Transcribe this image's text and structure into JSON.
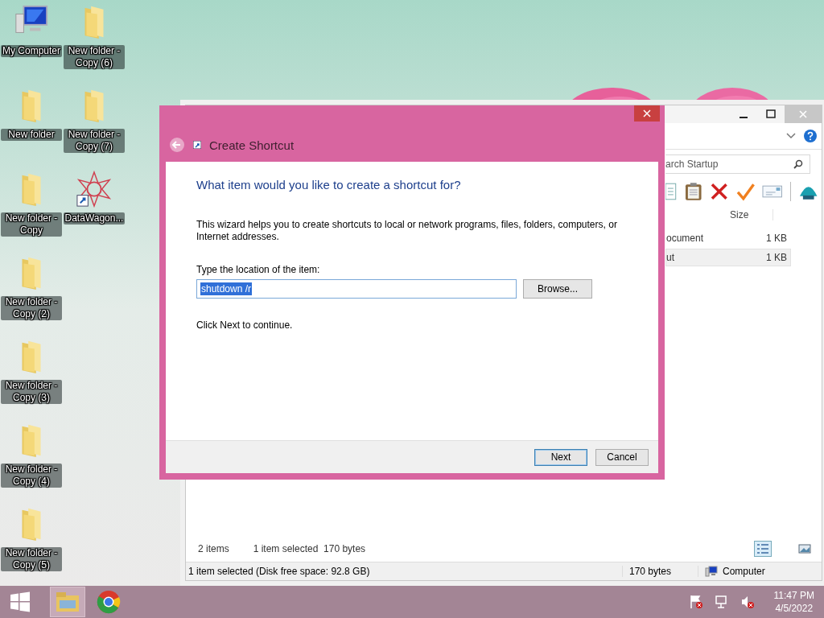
{
  "desktop_icons": [
    {
      "label": "My Computer",
      "kind": "computer"
    },
    {
      "label": "New folder",
      "kind": "folder"
    },
    {
      "label": "New folder - Copy",
      "kind": "folder"
    },
    {
      "label": "New folder - Copy (2)",
      "kind": "folder"
    },
    {
      "label": "New folder - Copy (3)",
      "kind": "folder"
    },
    {
      "label": "New folder - Copy (4)",
      "kind": "folder"
    },
    {
      "label": "New folder - Copy (5)",
      "kind": "folder"
    },
    {
      "label": "New folder - Copy (6)",
      "kind": "folder"
    },
    {
      "label": "New folder - Copy (7)",
      "kind": "folder"
    },
    {
      "label": "DataWagon...",
      "kind": "shortcut"
    }
  ],
  "explorer": {
    "search_placeholder": "arch Startup",
    "size_column": "Size",
    "files": [
      {
        "name": "ocument",
        "size": "1 KB",
        "selected": false
      },
      {
        "name": "ut",
        "size": "1 KB",
        "selected": true
      }
    ],
    "item_count": "2 items",
    "selection_info": "1 item selected  170 bytes",
    "status_bar": {
      "left": "1 item selected (Disk free space: 92.8 GB)",
      "size": "170 bytes",
      "location": "Computer"
    }
  },
  "dialog": {
    "title": "Create Shortcut",
    "heading": "What item would you like to create a shortcut for?",
    "description": "This wizard helps you to create shortcuts to local or network programs, files, folders, computers, or Internet addresses.",
    "field_label": "Type the location of the item:",
    "field_value": "shutdown /r",
    "value_selected": true,
    "browse": "Browse...",
    "hint": "Click Next to continue.",
    "buttons": [
      {
        "label": "Next",
        "default": true
      },
      {
        "label": "Cancel",
        "default": false
      }
    ]
  },
  "taskbar": {
    "time": "11:47 PM",
    "date": "4/5/2022"
  }
}
